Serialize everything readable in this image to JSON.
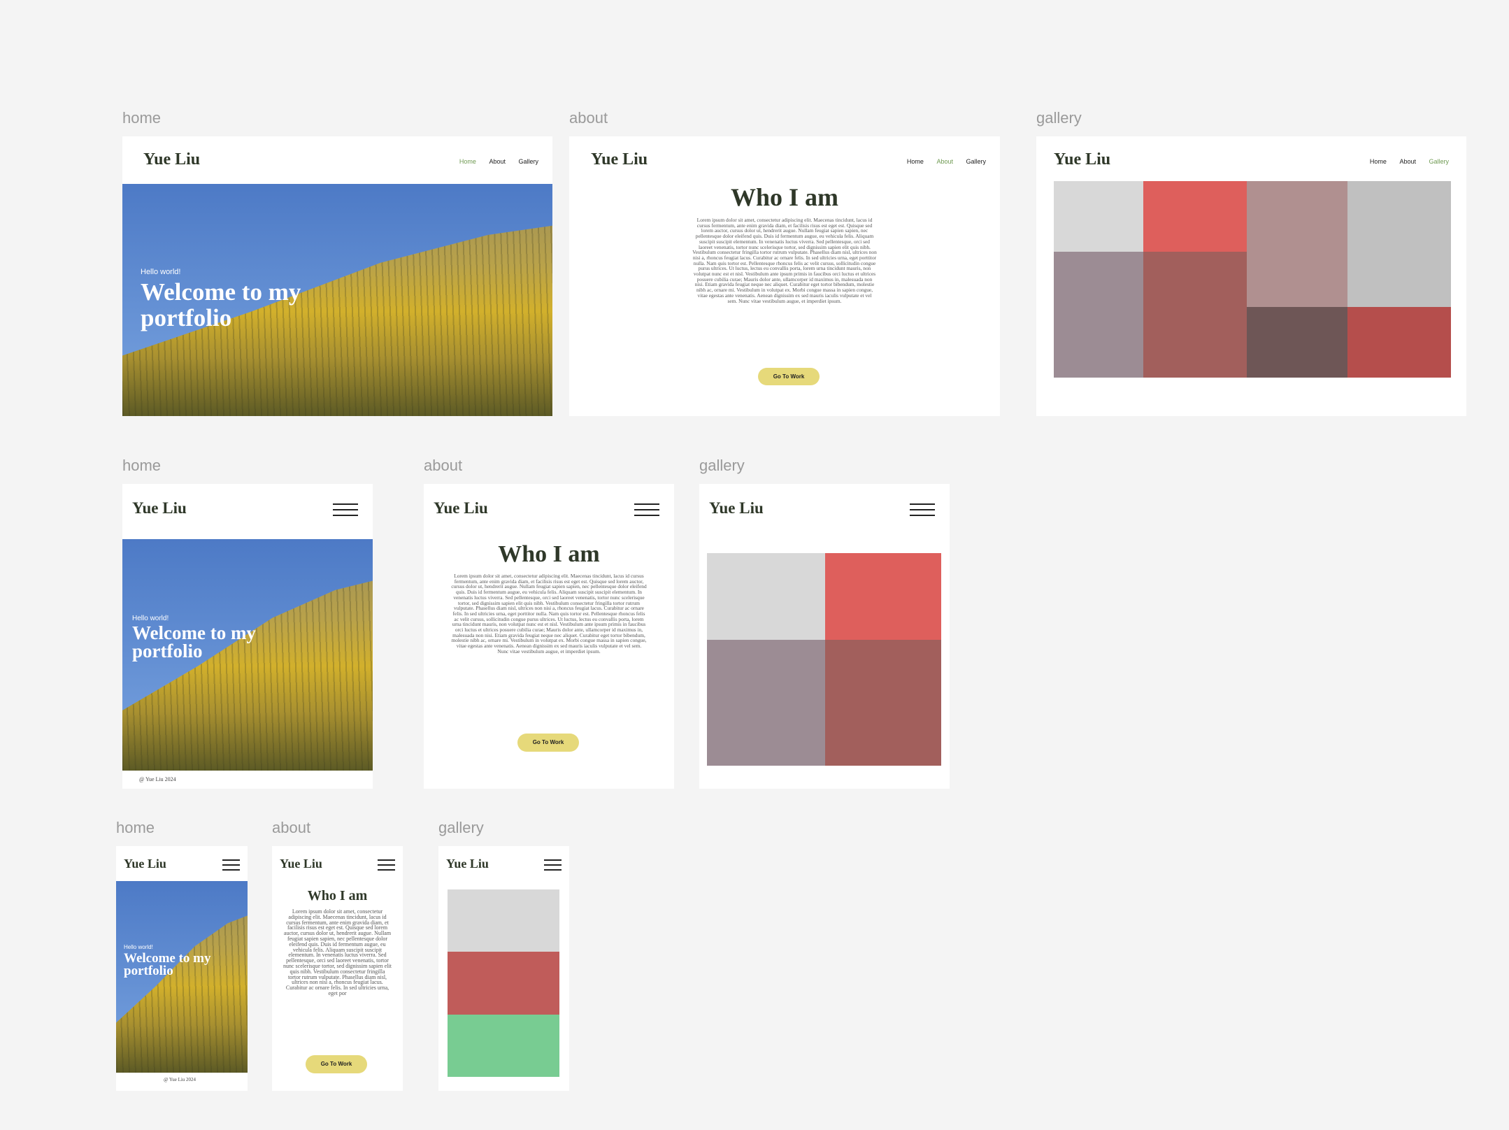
{
  "frames": {
    "home_label": "home",
    "about_label": "about",
    "gallery_label": "gallery"
  },
  "site": {
    "logo": "Yue Liu",
    "nav": [
      "Home",
      "About",
      "Gallery"
    ],
    "hero_subtitle": "Hello world!",
    "hero_title_line1": "Welcome to my",
    "hero_title_line2": "portfolio",
    "footer": "@ Yue Liu 2024"
  },
  "about": {
    "title": "Who I am",
    "body": "Lorem ipsum dolor sit amet, consectetur adipiscing elit. Maecenas tincidunt, lacus id cursus fermentum, ante enim gravida diam, et facilisis risus est eget est. Quisque sed lorem auctor, cursus dolor ut, hendrerit augue. Nullam feugiat sapien sapien, nec pellentesque dolor eleifend quis. Duis id fermentum augue, eu vehicula felis. Aliquam suscipit suscipit elementum. In venenatis luctus viverra. Sed pellentesque, orci sed laoreet venenatis, tortor nunc scelerisque tortor, sed dignissim sapien elit quis nibh. Vestibulum consectetur fringilla tortor rutrum vulputate. Phasellus diam nisl, ultrices non nisi a, rhoncus feugiat lacus. Curabitur ac ornare felis. In sed ultricies urna, eget porttitor nulla. Nam quis tortor est. Pellentesque rhoncus felis ac velit cursus, sollicitudin congue purus ultrices. Ut luctus, lectus eu convallis porta, lorem urna tincidunt mauris, non volutpat nunc est et nisl. Vestibulum ante ipsum primis in faucibus orci luctus et ultrices posuere cubilia curae; Mauris dolor ante, ullamcorper id maximus in, malesuada non nisi. Etiam gravida feugiat neque nec aliquet. Curabitur eget tortor bibendum, molestie nibh ac, ornare mi. Vestibulum in volutpat ex. Morbi congue massa in sapien congue, vitae egestas ante venenatis. Aenean dignissim ex sed mauris iaculis vulputate et vel sem. Nunc vitae vestibulum augue, et imperdiet ipsum.",
    "body_short": "Lorem ipsum dolor sit amet, consectetur adipiscing elit. Maecenas tincidunt, lacus id cursus fermentum, ante enim gravida diam, et facilisis risus est eget est. Quisque sed lorem auctor, cursus dolor ut, hendrerit augue. Nullam feugiat sapien sapien, nec pellentesque dolor eleifend quis. Duis id fermentum augue, eu vehicula felis. Aliquam suscipit suscipit elementum. In venenatis luctus viverra. Sed pellentesque, orci sed laoreet venenatis, tortor nunc scelerisque tortor, sed dignissim sapien elit quis nibh. Vestibulum consectetur fringilla tortor rutrum vulputate. Phasellus diam nisl, ultrices non nisi a, rhoncus feugiat lacus. Curabitur ac ornare felis. In sed ultricies urna, eget por",
    "button": "Go To Work"
  },
  "colors": {
    "accent_button": "#e6d97a",
    "active_nav": "#6f9a52",
    "logo_text": "#2f3829",
    "gallery_desktop": [
      "#d8d8d8",
      "#de5f5c",
      "#b09090",
      "#c0c0c0",
      "#9c8c94",
      "#a25f5c",
      "#6e5656",
      "#b54e4c"
    ],
    "gallery_tablet": [
      "#d8d8d8",
      "#de5f5c",
      "#9c8c94",
      "#a25f5c"
    ],
    "gallery_mobile": [
      "#d8d8d8",
      "#c05c5a",
      "#78cc92"
    ]
  }
}
